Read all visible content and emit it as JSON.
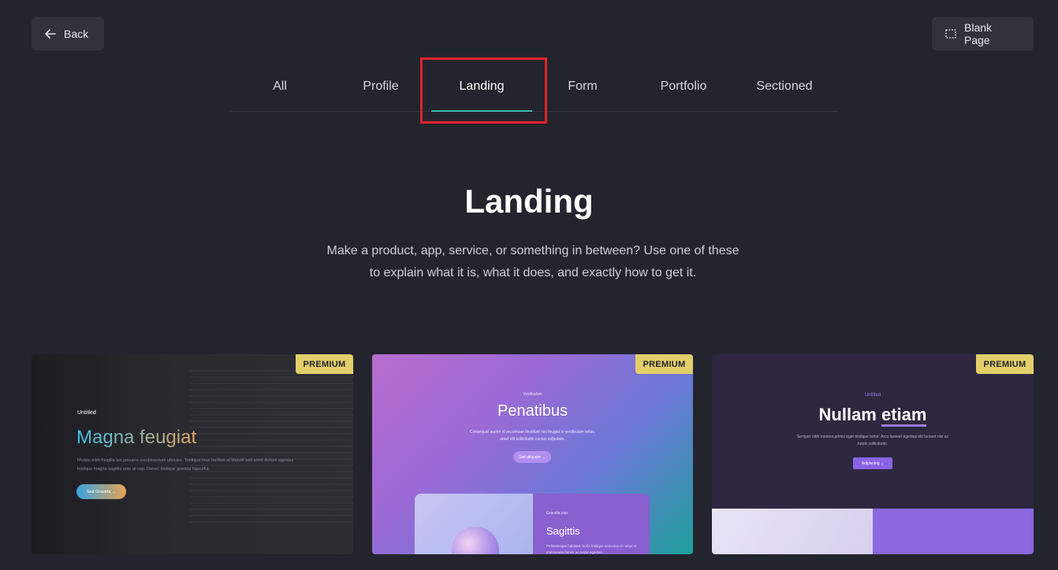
{
  "top_bar": {
    "back_label": "Back",
    "blank_page_label": "Blank Page"
  },
  "tabs": [
    {
      "label": "All",
      "active": false
    },
    {
      "label": "Profile",
      "active": false
    },
    {
      "label": "Landing",
      "active": true
    },
    {
      "label": "Form",
      "active": false
    },
    {
      "label": "Portfolio",
      "active": false
    },
    {
      "label": "Sectioned",
      "active": false
    }
  ],
  "section": {
    "title": "Landing",
    "description_line1": "Make a product, app, service, or something in between? Use one of these",
    "description_line2": "to explain what it is, what it does, and exactly how to get it."
  },
  "cards": [
    {
      "badge": "PREMIUM",
      "small": "Untitled",
      "title": "Magna feugiat",
      "text1": "Morbio nibh fringilla leo posuere condimentum ultricies. Tristique mus facilisis at blandit sed amet dictum egestas",
      "text2": "tristique magna sagittis ante at cep. Donec tristique gravida hascefut.",
      "button": "Sed Gravida →"
    },
    {
      "badge": "PREMIUM",
      "small": "Vestibulum",
      "title": "Penatibus",
      "text": "Consequat auctor id accumsan tincidunt nisi feugiat in vestibulum tellus, amet elit sollicitudin cursus vulputate.",
      "button": "Sed aliquam →",
      "panel_small": "Gravida cep",
      "panel_title": "Sagittis",
      "panel_text": "Pellentesque habitant morbi tristique senectus et netus et malesuada fames ac turpis egestas."
    },
    {
      "badge": "PREMIUM",
      "small": "Untitled",
      "title_plain": "Nullam",
      "title_underlined": "etiam",
      "text": "Semper nibh montes primis eget tristique tortor. Arcu laoreet egestas elit laoreet nisl ac turpis sollicitudin.",
      "button": "Adipiscing ⌄"
    }
  ],
  "colors": {
    "background": "#24242e",
    "tab_active_underline": "#3fb9b0",
    "highlight_box": "#e0232a",
    "badge": "#e2cf6a"
  },
  "icons": {
    "back": "arrow-left-icon",
    "blank_page": "dashed-square-icon"
  }
}
